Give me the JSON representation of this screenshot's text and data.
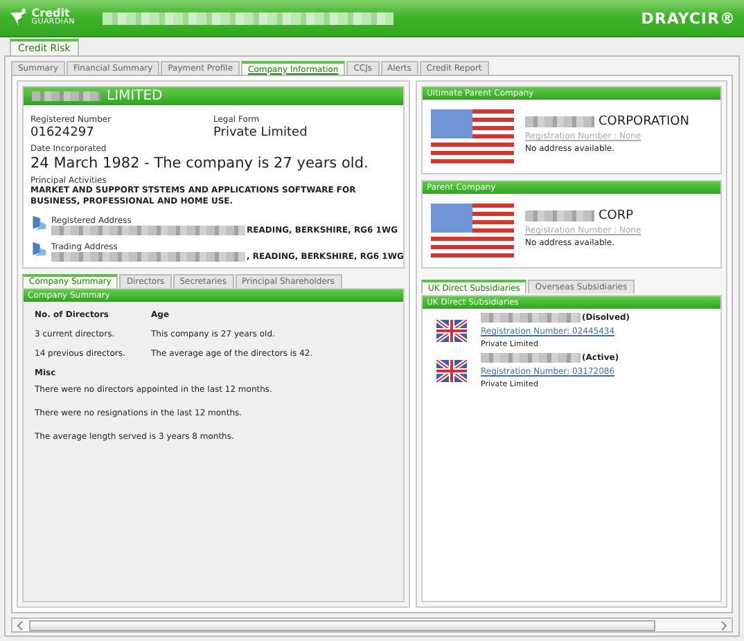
{
  "header": {
    "logo_text": "Credit",
    "logo_subtext": "GUARDIAN",
    "brand": "DRAYCIR®"
  },
  "outer_tabs": [
    {
      "label": "Credit Risk",
      "selected": true
    }
  ],
  "tabs": [
    {
      "label": "Summary",
      "selected": false
    },
    {
      "label": "Financial Summary",
      "selected": false
    },
    {
      "label": "Payment Profile",
      "selected": false
    },
    {
      "label": "Company Information",
      "selected": true
    },
    {
      "label": "CCJs",
      "selected": false
    },
    {
      "label": "Alerts",
      "selected": false
    },
    {
      "label": "Credit Report",
      "selected": false
    }
  ],
  "company": {
    "name_suffix": "LIMITED",
    "registered_number_label": "Registered Number",
    "registered_number": "01624297",
    "legal_form_label": "Legal Form",
    "legal_form": "Private Limited",
    "date_label": "Date Incorporated",
    "date": "24 March 1982 - The company is 27 years old.",
    "activities_label": "Principal Activities",
    "activities": "MARKET AND SUPPORT STSTEMS AND APPLICATIONS SOFTWARE FOR BUSINESS, PROFESSIONAL AND HOME USE.",
    "addresses": [
      {
        "label": "Registered Address",
        "tail": "READING, BERKSHIRE, RG6 1WG"
      },
      {
        "label": "Trading Address",
        "tail": ", READING, BERKSHIRE, RG6 1WG"
      }
    ]
  },
  "summary_tabs": [
    {
      "label": "Company Summary",
      "selected": true
    },
    {
      "label": "Directors",
      "selected": false
    },
    {
      "label": "Secretaries",
      "selected": false
    },
    {
      "label": "Principal Shareholders",
      "selected": false
    }
  ],
  "summary": {
    "title": "Company Summary",
    "col_1_heading": "No. of Directors",
    "col_2_heading": "Age",
    "rows": [
      [
        "3 current directors.",
        "This company is 27 years old."
      ],
      [
        "14 previous directors.",
        "The average age of the directors is 42."
      ]
    ],
    "misc_heading": "Misc",
    "misc": [
      "There were no directors appointed in the last 12 months.",
      "There were no resignations in the last 12 months.",
      "The average length served is 3 years 8 months."
    ]
  },
  "parents": [
    {
      "title": "Ultimate Parent Company",
      "name_suffix": "CORPORATION",
      "registration": "Registration Number : None",
      "link_enabled": false,
      "address": "No address available."
    },
    {
      "title": "Parent Company",
      "name_suffix": "CORP",
      "registration": "Registration Number : None",
      "link_enabled": false,
      "address": "No address available."
    }
  ],
  "subsidiary_tabs": [
    {
      "label": "UK Direct Subsidiaries",
      "selected": true
    },
    {
      "label": "Overseas Subsidiaries",
      "selected": false
    }
  ],
  "subsidiaries": {
    "title": "UK Direct Subsidiaries",
    "items": [
      {
        "status": "(Disolved)",
        "registration": "Registration Number: 02445434",
        "link_enabled": true,
        "legal_form": "Private Limited"
      },
      {
        "status": "(Active)",
        "registration": "Registration Number: 03172086",
        "link_enabled": true,
        "legal_form": "Private Limited"
      }
    ]
  }
}
